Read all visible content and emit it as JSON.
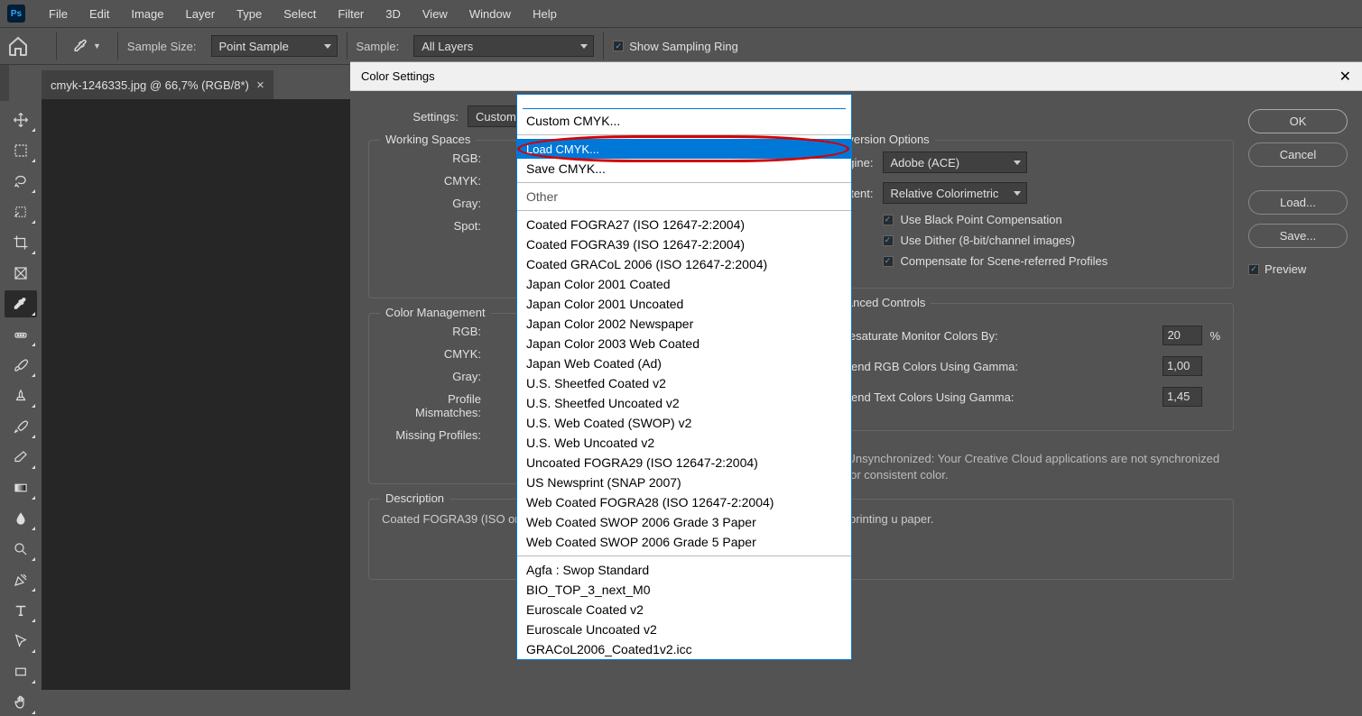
{
  "app": {
    "logo": "Ps"
  },
  "menubar": [
    "File",
    "Edit",
    "Image",
    "Layer",
    "Type",
    "Select",
    "Filter",
    "3D",
    "View",
    "Window",
    "Help"
  ],
  "options": {
    "sample_size_label": "Sample Size:",
    "sample_size_value": "Point Sample",
    "sample_label": "Sample:",
    "sample_value": "All Layers",
    "show_ring": "Show Sampling Ring"
  },
  "document": {
    "tab": "cmyk-1246335.jpg @ 66,7% (RGB/8*)"
  },
  "dialog": {
    "title": "Color Settings",
    "settings_label": "Settings:",
    "settings_value": "Custom",
    "working_spaces": {
      "legend": "Working Spaces",
      "rgb": "RGB:",
      "cmyk": "CMYK:",
      "gray": "Gray:",
      "spot": "Spot:"
    },
    "color_mgmt": {
      "legend": "Color Management",
      "rgb": "RGB:",
      "cmyk": "CMYK:",
      "gray": "Gray:",
      "profile_mismatches": "Profile Mismatches:",
      "missing_profiles": "Missing Profiles:"
    },
    "description": {
      "legend": "Description",
      "text": "Coated FOGRA39 (ISO                                                                                                     on. It is designed to produce quality separations for standard ISO printing u                                                                                                      paper."
    },
    "conversion": {
      "legend": "Conversion Options",
      "engine_label": "Engine:",
      "engine_value": "Adobe (ACE)",
      "intent_label": "Intent:",
      "intent_value": "Relative Colorimetric",
      "bpc": "Use Black Point Compensation",
      "dither": "Use Dither (8-bit/channel images)",
      "scene": "Compensate for Scene-referred Profiles"
    },
    "advanced": {
      "legend": "Advanced Controls",
      "desaturate": "Desaturate Monitor Colors By:",
      "desaturate_val": "20",
      "pct": "%",
      "blend_rgb": "Blend RGB Colors Using Gamma:",
      "blend_rgb_val": "1,00",
      "blend_text": "Blend Text Colors Using Gamma:",
      "blend_text_val": "1,45"
    },
    "unsync": "Unsynchronized: Your Creative Cloud applications are not synchronized for consistent color.",
    "buttons": {
      "ok": "OK",
      "cancel": "Cancel",
      "load": "Load...",
      "save": "Save...",
      "preview": "Preview"
    }
  },
  "dropdown": {
    "group1": [
      "Custom CMYK..."
    ],
    "group2": [
      "Load CMYK...",
      "Save CMYK..."
    ],
    "other_label": "Other",
    "group3": [
      "Coated FOGRA27 (ISO 12647-2:2004)",
      "Coated FOGRA39 (ISO 12647-2:2004)",
      "Coated GRACoL 2006 (ISO 12647-2:2004)",
      "Japan Color 2001 Coated",
      "Japan Color 2001 Uncoated",
      "Japan Color 2002 Newspaper",
      "Japan Color 2003 Web Coated",
      "Japan Web Coated (Ad)",
      "U.S. Sheetfed Coated v2",
      "U.S. Sheetfed Uncoated v2",
      "U.S. Web Coated (SWOP) v2",
      "U.S. Web Uncoated v2",
      "Uncoated FOGRA29 (ISO 12647-2:2004)",
      "US Newsprint (SNAP 2007)",
      "Web Coated FOGRA28 (ISO 12647-2:2004)",
      "Web Coated SWOP 2006 Grade 3 Paper",
      "Web Coated SWOP 2006 Grade 5 Paper"
    ],
    "group4": [
      "Agfa : Swop Standard",
      "BIO_TOP_3_next_M0",
      "Euroscale Coated v2",
      "Euroscale Uncoated v2",
      "GRACoL2006_Coated1v2.icc"
    ]
  }
}
